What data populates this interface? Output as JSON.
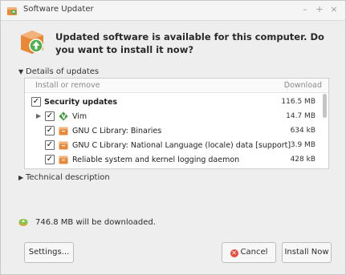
{
  "window": {
    "title": "Software Updater",
    "controls": {
      "minimize": "–",
      "maximize": "+",
      "close": "×"
    }
  },
  "header": {
    "message": "Updated software is available for this computer. Do you want to install it now?"
  },
  "details": {
    "expander_label": "Details of updates",
    "columns": {
      "name": "Install or remove",
      "size": "Download"
    },
    "rows": [
      {
        "label": "Security updates",
        "size": "116.5 MB"
      },
      {
        "label": "Vim",
        "size": "14.7 MB"
      },
      {
        "label": "GNU C Library: Binaries",
        "size": "634 kB"
      },
      {
        "label": "GNU C Library: National Language (locale) data [support]",
        "size": "3.9 MB"
      },
      {
        "label": "Reliable system and kernel logging daemon",
        "size": "428 kB"
      }
    ]
  },
  "technical": {
    "expander_label": "Technical description"
  },
  "footer": {
    "download_status": "746.8 MB will be downloaded."
  },
  "buttons": {
    "settings": "Settings...",
    "cancel": "Cancel",
    "install": "Install Now"
  },
  "colors": {
    "accent_green": "#4caf50",
    "cancel_red": "#e74c3c",
    "package_orange": "#e8893a"
  }
}
